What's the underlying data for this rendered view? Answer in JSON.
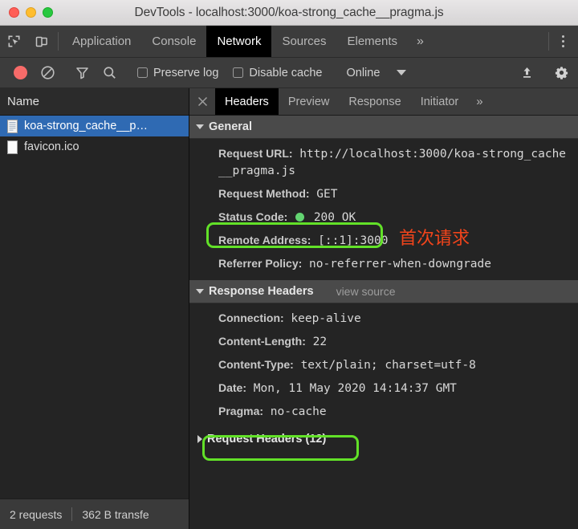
{
  "window": {
    "title": "DevTools - localhost:3000/koa-strong_cache__pragma.js",
    "controls": {
      "close": "close-window",
      "minimize": "minimize-window",
      "maximize": "maximize-window"
    }
  },
  "main_tabs": {
    "inspect_icon": "inspect-element-icon",
    "device_icon": "device-toolbar-icon",
    "items": [
      {
        "label": "Application",
        "active": false
      },
      {
        "label": "Console",
        "active": false
      },
      {
        "label": "Network",
        "active": true
      },
      {
        "label": "Sources",
        "active": false
      },
      {
        "label": "Elements",
        "active": false
      }
    ],
    "overflow": "»",
    "menu_icon": "kebab-menu-icon"
  },
  "network_toolbar": {
    "record_icon": "record-button",
    "clear_icon": "clear-icon",
    "filter_icon": "filter-icon",
    "search_icon": "search-icon",
    "preserve_log": {
      "label": "Preserve log",
      "checked": false
    },
    "disable_cache": {
      "label": "Disable cache",
      "checked": false
    },
    "throttling": {
      "value": "Online",
      "caret": "chevron-down-icon"
    },
    "import_icon": "import-har-icon",
    "settings_icon": "gear-icon"
  },
  "request_list": {
    "column_header": "Name",
    "rows": [
      {
        "name": "koa-strong_cache__p…",
        "selected": true
      },
      {
        "name": "favicon.ico",
        "selected": false
      }
    ]
  },
  "status_bar": {
    "requests": "2 requests",
    "transferred": "362 B transfe"
  },
  "detail_tabs": {
    "close_icon": "close-icon",
    "items": [
      {
        "label": "Headers",
        "active": true
      },
      {
        "label": "Preview",
        "active": false
      },
      {
        "label": "Response",
        "active": false
      },
      {
        "label": "Initiator",
        "active": false
      }
    ],
    "overflow": "»"
  },
  "sections": {
    "general": {
      "title": "General",
      "expanded": true,
      "rows": [
        {
          "name": "Request URL:",
          "value": "http://localhost:3000/koa-strong_cache__pragma.js",
          "wrap": true
        },
        {
          "name": "Request Method:",
          "value": "GET"
        },
        {
          "name": "Status Code:",
          "value": "200 OK",
          "status_dot": true
        },
        {
          "name": "Remote Address:",
          "value": "[::1]:3000"
        },
        {
          "name": "Referrer Policy:",
          "value": "no-referrer-when-downgrade"
        }
      ]
    },
    "response_headers": {
      "title": "Response Headers",
      "expanded": true,
      "view_source": "view source",
      "rows": [
        {
          "name": "Connection:",
          "value": "keep-alive"
        },
        {
          "name": "Content-Length:",
          "value": "22"
        },
        {
          "name": "Content-Type:",
          "value": "text/plain; charset=utf-8"
        },
        {
          "name": "Date:",
          "value": "Mon, 11 May 2020 14:14:37 GMT"
        },
        {
          "name": "Pragma:",
          "value": "no-cache"
        }
      ]
    },
    "request_headers": {
      "title": "Request Headers (12)",
      "expanded": false
    }
  },
  "annotations": {
    "note_first_request": "首次请求",
    "highlight_color": "#62e128",
    "note_color": "#f1441b"
  }
}
